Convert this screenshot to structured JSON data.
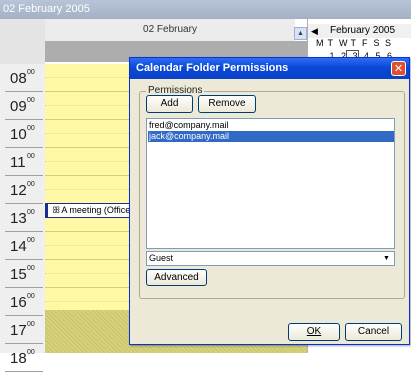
{
  "window": {
    "title": "02 February 2005"
  },
  "day_view": {
    "day_header": "02 February",
    "hours": [
      {
        "h": "08",
        "m": "00"
      },
      {
        "h": "09",
        "m": "00"
      },
      {
        "h": "10",
        "m": "00"
      },
      {
        "h": "11",
        "m": "00"
      },
      {
        "h": "12",
        "m": "00"
      },
      {
        "h": "13",
        "m": "00"
      },
      {
        "h": "14",
        "m": "00"
      },
      {
        "h": "15",
        "m": "00"
      },
      {
        "h": "16",
        "m": "00"
      },
      {
        "h": "17",
        "m": "00"
      },
      {
        "h": "18",
        "m": "00"
      }
    ],
    "appointment": {
      "icon": "meeting-icon",
      "text": "A meeting (Office"
    },
    "colors": {
      "work_hours": "#fff9a6",
      "after_hours": "#d6d27a"
    }
  },
  "mini_calendar": {
    "prev_symbol": "◀",
    "title": "February 2005",
    "weekdays": [
      "M",
      "T",
      "W",
      "T",
      "F",
      "S",
      "S"
    ],
    "partial_row": [
      "1",
      "2",
      "3",
      "4",
      "5",
      "6"
    ]
  },
  "dialog": {
    "title": "Calendar Folder Permissions",
    "close_symbol": "✕",
    "group_label": "Permissions",
    "add_label": "Add",
    "remove_label": "Remove",
    "users": [
      "fred@company.mail",
      "jack@company.mail"
    ],
    "selected_user_index": 1,
    "role_value": "Guest",
    "advanced_label": "Advanced",
    "ok_label": "OK",
    "cancel_label": "Cancel",
    "title_color": "#0a48d8",
    "selection_color": "#316ac5"
  }
}
